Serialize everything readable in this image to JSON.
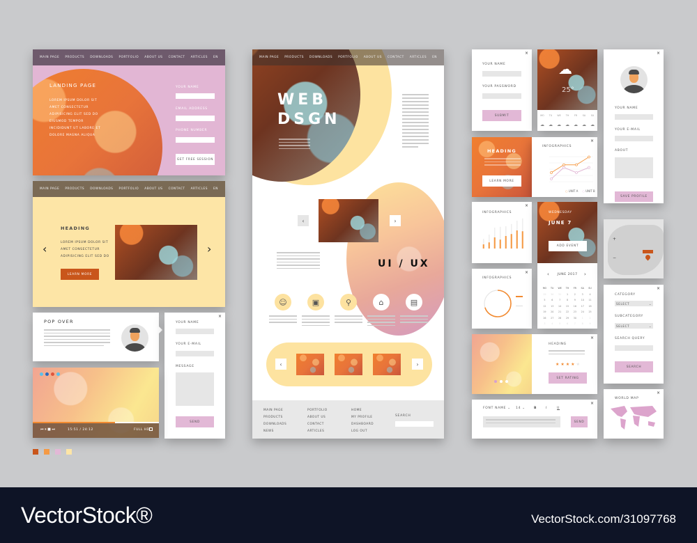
{
  "nav": [
    "MAIN PAGE",
    "PRODUCTS",
    "DOWNLOADS",
    "PORTFOLIO",
    "ABOUT US",
    "CONTACT",
    "ARTICLES",
    "EN"
  ],
  "colors": {
    "accent_orange": "#f28a30",
    "dark_orange": "#c9561b",
    "pink": "#e2b8d6",
    "yellow": "#fde5a6",
    "nav_mauve": "#6e5a6c",
    "nav_brown": "#7a6a55"
  },
  "landing": {
    "title": "LANDING PAGE",
    "lines": [
      "LOREM IPSUM DOLOR SIT",
      "AMET CONSECTETUR",
      "ADIPISICING ELIT SED DO",
      "EIUSMOD TEMPOR",
      "INCIDIDUNT UT LABORE ET",
      "DOLORE MAGNA ALIQUA"
    ],
    "name_label": "YOUR NAME",
    "email_label": "EMAIL ADDRESS",
    "phone_label": "PHONE NUMBER",
    "button": "GET FREE SESSION"
  },
  "slider": {
    "heading": "HEADING",
    "lines": [
      "LOREM IPSUM DOLOR SIT",
      "AMET CONSECTETUR",
      "ADIPISICING ELIT SED DO"
    ],
    "button": "LEARN MORE",
    "prev": "‹",
    "next": "›"
  },
  "popover": {
    "title": "POP OVER"
  },
  "contact": {
    "name_label": "YOUR NAME",
    "email_label": "YOUR E-MAIL",
    "message_label": "MESSAGE",
    "button": "SEND"
  },
  "video": {
    "time": "15:51 / 24:12",
    "quality": "FULL HD",
    "progress": 0.65
  },
  "swatches": [
    "#c9561b",
    "#f59a45",
    "#e2b8d6",
    "#fde5a6"
  ],
  "hero": {
    "title1": "WEB",
    "title2": "DSGN",
    "uiux": "UI / UX"
  },
  "footer": {
    "cols": [
      [
        "MAIN PAGE",
        "PRODUCTS",
        "DOWNLOADS",
        "NEWS"
      ],
      [
        "PORTFOLIO",
        "ABOUT US",
        "CONTACT",
        "ARTICLES"
      ],
      [
        "HOME",
        "MY PROFILE",
        "DASHBOARD",
        "LOG OUT"
      ]
    ],
    "search_label": "SEARCH"
  },
  "login": {
    "name_label": "YOUR NAME",
    "password_label": "YOUR PASSWORD",
    "button": "SUBMIT"
  },
  "weather": {
    "temp": "25°",
    "days": [
      "MO",
      "TU",
      "WE",
      "TH",
      "FR",
      "SA",
      "SU"
    ]
  },
  "promo": {
    "heading": "HEADING",
    "button": "LEARN MORE"
  },
  "line_chart": {
    "title": "INFOGRAPHICS",
    "series": [
      {
        "name": "UNIT A",
        "color": "#f59a45",
        "values": [
          20,
          35,
          35,
          50
        ]
      },
      {
        "name": "UNIT B",
        "color": "#e2b8d6",
        "values": [
          8,
          30,
          20,
          30
        ]
      }
    ]
  },
  "bar_chart": {
    "title": "INFOGRAPHICS",
    "values": [
      15,
      22,
      40,
      32,
      45,
      52,
      65,
      62
    ],
    "max": [
      35,
      50,
      75,
      78,
      80,
      88,
      100,
      108
    ]
  },
  "donut": {
    "title": "INFOGRAPHICS",
    "fraction": 0.7
  },
  "event": {
    "day": "WEDNESDAY",
    "date": "JUNE 7",
    "button": "ADD EVENT"
  },
  "calendar": {
    "month": "JUNE 2017",
    "days": [
      "MO",
      "TU",
      "WE",
      "TH",
      "FR",
      "SA",
      "SU"
    ],
    "dates": [
      "29",
      "30",
      "31",
      "1",
      "2",
      "3",
      "4",
      "5",
      "6",
      "7",
      "8",
      "9",
      "10",
      "11",
      "12",
      "13",
      "14",
      "15",
      "16",
      "17",
      "18",
      "19",
      "20",
      "21",
      "22",
      "23",
      "24",
      "25",
      "26",
      "27",
      "28",
      "29",
      "30",
      "1",
      "2",
      "3",
      "4",
      "5",
      "6",
      "7",
      "8",
      "9"
    ]
  },
  "rating": {
    "heading": "HEADING",
    "stars": 4,
    "max": 5,
    "button": "SET RATING"
  },
  "editor": {
    "font": "FONT NAME",
    "size": "14",
    "bold": "B",
    "italic": "I",
    "underline": "U",
    "button": "SEND"
  },
  "profile": {
    "name_label": "YOUR NAME",
    "email_label": "YOUR E-MAIL",
    "about_label": "ABOUT",
    "button": "SAVE PROFILE"
  },
  "search": {
    "category_label": "CATEGORY",
    "subcategory_label": "SUBCATEGORY",
    "query_label": "SEARCH QUERY",
    "select": "SELECT",
    "button": "SEARCH"
  },
  "worldmap": {
    "title": "WORLD MAP"
  },
  "watermark": {
    "brand": "VectorStock®",
    "id": "VectorStock.com/31097768"
  }
}
